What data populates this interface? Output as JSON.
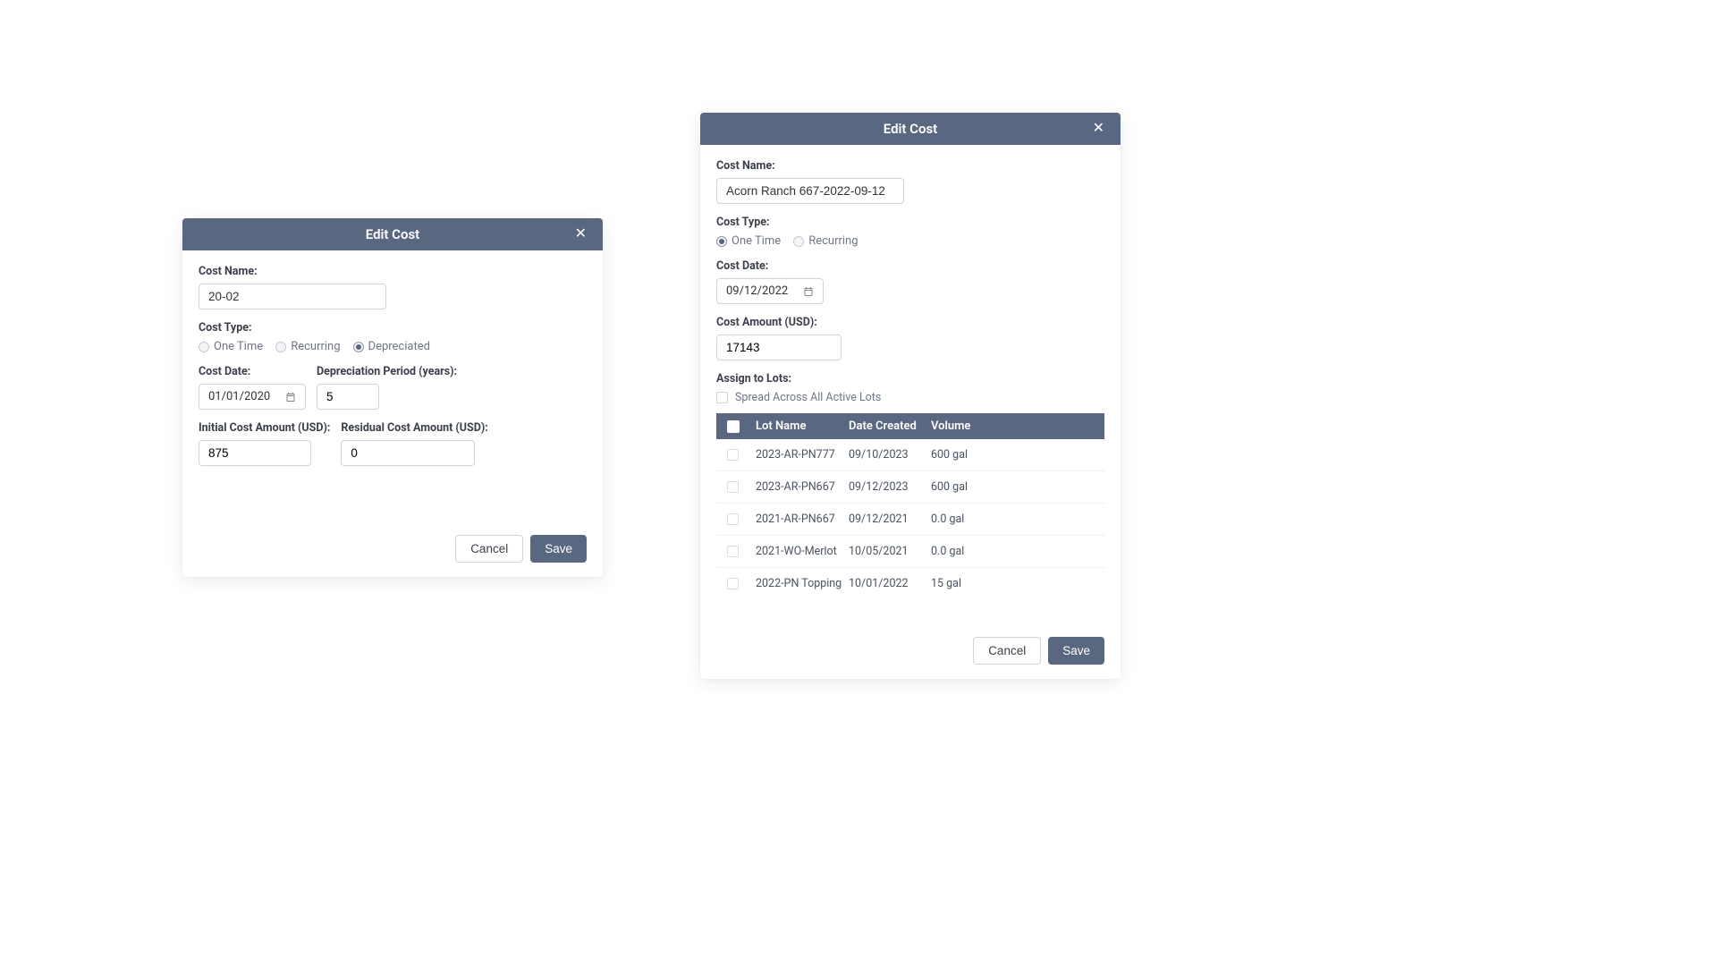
{
  "left": {
    "title": "Edit Cost",
    "labels": {
      "costName": "Cost Name:",
      "costType": "Cost Type:",
      "costDate": "Cost Date:",
      "deprPeriod": "Depreciation Period (years):",
      "initialAmount": "Initial Cost Amount (USD):",
      "residualAmount": "Residual Cost Amount (USD):"
    },
    "values": {
      "costName": "20-02",
      "costDate": "01/01/2020",
      "deprPeriod": "5",
      "initialAmount": "875",
      "residualAmount": "0"
    },
    "radios": {
      "oneTime": "One Time",
      "recurring": "Recurring",
      "depreciated": "Depreciated"
    },
    "buttons": {
      "cancel": "Cancel",
      "save": "Save"
    }
  },
  "right": {
    "title": "Edit Cost",
    "labels": {
      "costName": "Cost Name:",
      "costType": "Cost Type:",
      "costDate": "Cost Date:",
      "costAmount": "Cost Amount (USD):",
      "assignLots": "Assign to Lots:",
      "spread": "Spread Across All Active Lots"
    },
    "values": {
      "costName": "Acorn Ranch 667-2022-09-12",
      "costDate": "09/12/2022",
      "costAmount": "17143"
    },
    "radios": {
      "oneTime": "One Time",
      "recurring": "Recurring"
    },
    "table": {
      "headers": {
        "lotName": "Lot Name",
        "dateCreated": "Date Created",
        "volume": "Volume"
      },
      "rows": [
        {
          "lot": "2023-AR-PN777",
          "date": "09/10/2023",
          "vol": "600 gal"
        },
        {
          "lot": "2023-AR-PN667",
          "date": "09/12/2023",
          "vol": "600 gal"
        },
        {
          "lot": "2021-AR-PN667",
          "date": "09/12/2021",
          "vol": "0.0 gal"
        },
        {
          "lot": "2021-WO-Merlot",
          "date": "10/05/2021",
          "vol": "0.0 gal"
        },
        {
          "lot": "2022-PN Topping",
          "date": "10/01/2022",
          "vol": "15 gal"
        }
      ]
    },
    "buttons": {
      "cancel": "Cancel",
      "save": "Save"
    }
  }
}
